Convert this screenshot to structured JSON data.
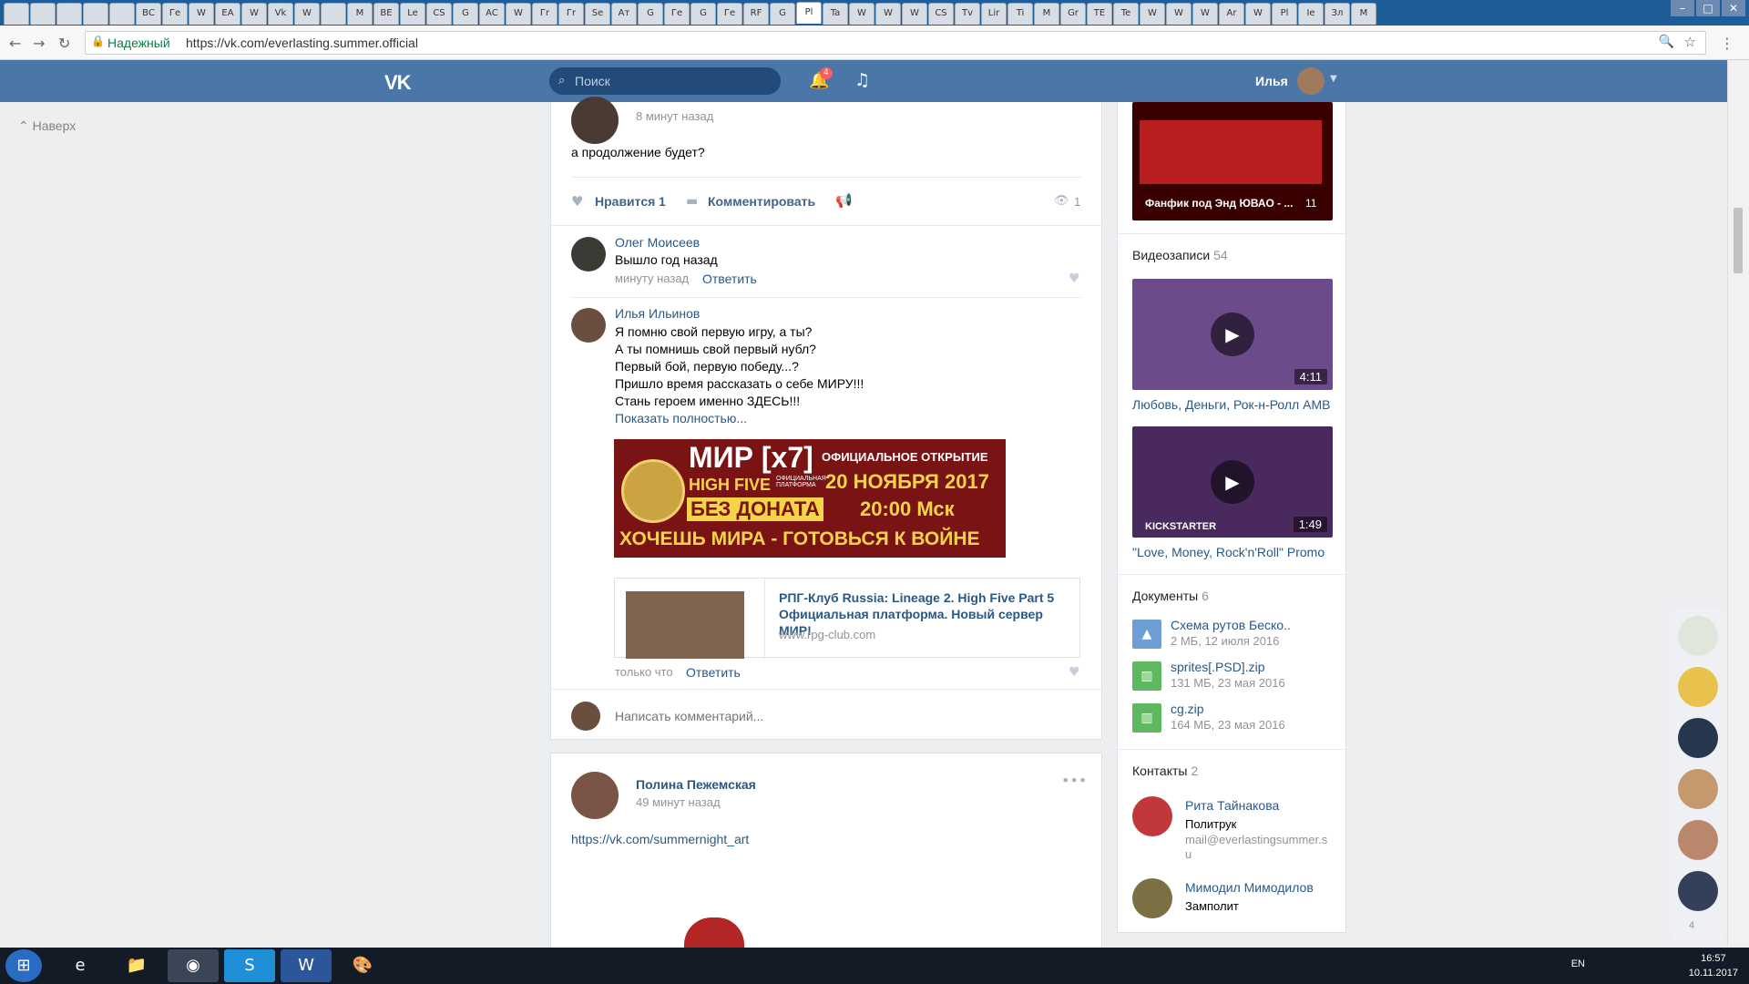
{
  "browser": {
    "tabs": [
      "",
      "",
      "",
      "",
      "",
      "ВС",
      "Ге",
      "W",
      "EA",
      "W",
      "Vk",
      "W",
      "",
      "M",
      "ВЕ",
      "Le",
      "CS",
      "G",
      "AC",
      "W",
      "Гr",
      "Гr",
      "Se",
      "Aт",
      "G",
      "Ге",
      "G",
      "Ге",
      "RF",
      "G",
      "Pl",
      "Ta",
      "W",
      "W",
      "W",
      "CS",
      "Tv",
      "Lir",
      "Ti",
      "M",
      "Gr",
      "TE",
      "Te",
      "W",
      "W",
      "W",
      "Ar",
      "W",
      "Pl",
      "Ie",
      "Зл",
      "M"
    ],
    "secure_label": "Надежный",
    "url": "https://vk.com/everlasting.summer.official",
    "window_controls": [
      "–",
      "□",
      "✕"
    ]
  },
  "vk_header": {
    "logo": "VK",
    "search_placeholder": "Поиск",
    "notif_count": "4",
    "username": "Илья"
  },
  "left": {
    "up_label": "Наверх"
  },
  "post1": {
    "time": "8 минут назад",
    "text": "а продолжение будет?",
    "like_label": "Нравится",
    "like_count": "1",
    "comment_label": "Комментировать",
    "views": "1"
  },
  "comments": [
    {
      "author": "Олег Моисеев",
      "text": "Вышло год назад",
      "time": "минуту назад",
      "reply": "Ответить"
    },
    {
      "author": "Илья Ильинов",
      "lines": [
        "Я помню свой первую игру, а ты?",
        "А ты помнишь свой первый нубл?",
        "Первый бой, первую победу...?",
        "Пришло время рассказать о себе МИРУ!!!",
        "Стань героем именно ЗДЕСЬ!!!"
      ],
      "show_more": "Показать полностью...",
      "banner": {
        "line1": "МИР [x7]",
        "line1b": "ОФИЦИАЛЬНОЕ ОТКРЫТИЕ",
        "line2": "HIGH FIVE",
        "line2b": "20 НОЯБРЯ 2017",
        "line3": "БЕЗ ДОНАТА",
        "line3b": "20:00 Мск",
        "line4": "ХОЧЕШЬ МИРА - ГОТОВЬСЯ К ВОЙНЕ",
        "small": "ОФИЦИАЛЬНАЯ ПЛАТФОРМА"
      },
      "snippet_title": "РПГ-Клуб Russia: Lineage 2. High Five Part 5 Официальная платформа. Новый сервер МИР!",
      "snippet_domain": "www.rpg-club.com",
      "time": "только что",
      "reply": "Ответить"
    }
  ],
  "write_comment_placeholder": "Написать комментарий...",
  "post2": {
    "author": "Полина Пежемская",
    "time": "49 минут назад",
    "link": "https://vk.com/summernight_art",
    "menu": "•••"
  },
  "right": {
    "top_video_caption": "Фанфик под Энд ЮВАО - ...",
    "top_video_count": "11",
    "videos_title": "Видеозаписи",
    "videos_count": "54",
    "videos": [
      {
        "title": "Любовь, Деньги, Рок-н-Ролл AMB",
        "duration": "4:11",
        "color": "#6c4b8a"
      },
      {
        "title": "\"Love, Money, Rock'n'Roll\" Promo",
        "duration": "1:49",
        "color": "#4a2a5e",
        "overlay": "KICKSTARTER"
      }
    ],
    "docs_title": "Документы",
    "docs_count": "6",
    "docs": [
      {
        "name": "Схема рутов Беско..",
        "meta": "2 МБ, 12 июля 2016",
        "color": "#6d9fd6",
        "icon": "image-icon"
      },
      {
        "name": "sprites[.PSD].zip",
        "meta": "131 МБ, 23 мая 2016",
        "color": "#5fb75f",
        "icon": "archive-icon"
      },
      {
        "name": "cg.zip",
        "meta": "164 МБ, 23 мая 2016",
        "color": "#5fb75f",
        "icon": "archive-icon"
      }
    ],
    "contacts_title": "Контакты",
    "contacts_count": "2",
    "contacts": [
      {
        "name": "Рита Тайнакова",
        "role": "Политрук",
        "email": "mail@everlastingsummer.s",
        "email2": "u"
      },
      {
        "name": "Мимодил Мимодилов",
        "role": "Замполит"
      }
    ]
  },
  "chatbar": {
    "count": "4"
  },
  "taskbar": {
    "lang": "EN",
    "time": "16:57",
    "date": "10.11.2017"
  }
}
